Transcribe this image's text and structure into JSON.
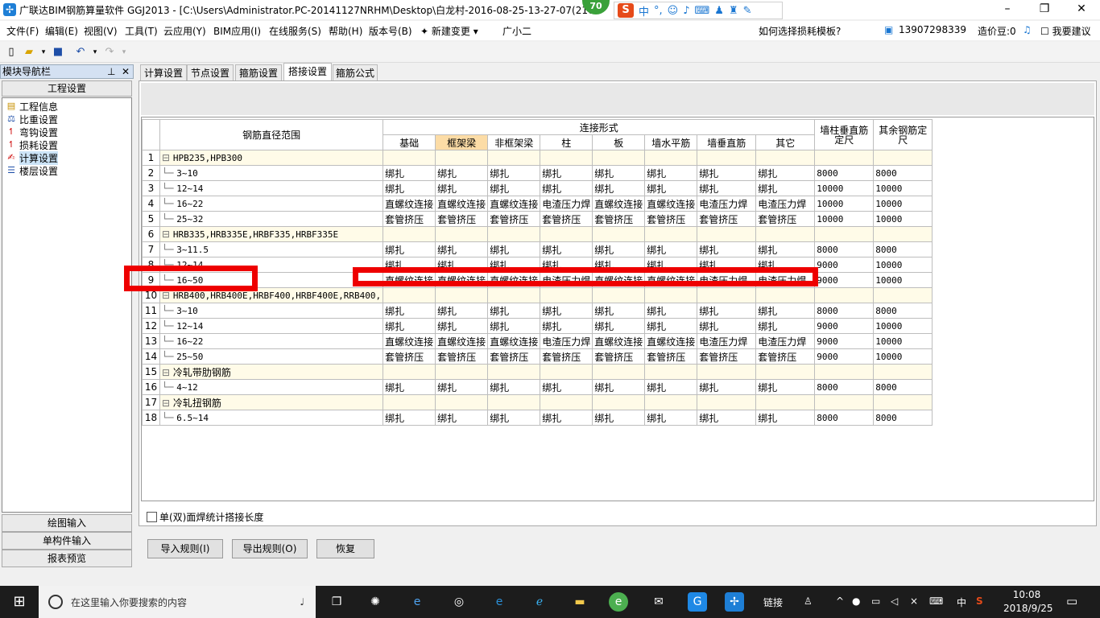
{
  "window": {
    "title": "广联达BIM钢筋算量软件 GGJ2013 - [C:\\Users\\Administrator.PC-20141127NRHM\\Desktop\\白龙村-2016-08-25-13-27-07(216",
    "badge": "70",
    "ime": {
      "logo": "S",
      "mode": "中",
      "punct": "°,"
    }
  },
  "menu": {
    "items": [
      "文件(F)",
      "编辑(E)",
      "视图(V)",
      "工具(T)",
      "云应用(Y)",
      "BIM应用(I)",
      "在线服务(S)",
      "帮助(H)",
      "版本号(B)",
      "新建变更",
      "广小二"
    ],
    "hint": "如何选择损耗模板?",
    "user": "13907298339",
    "coins": "造价豆:0",
    "feedback": "我要建议"
  },
  "nav": {
    "header": "模块导航栏",
    "section": "工程设置",
    "items": [
      {
        "label": "工程信息",
        "icon": "project-info-icon"
      },
      {
        "label": "比重设置",
        "icon": "weight-icon"
      },
      {
        "label": "弯钩设置",
        "icon": "hook-icon"
      },
      {
        "label": "损耗设置",
        "icon": "loss-icon"
      },
      {
        "label": "计算设置",
        "icon": "calc-icon"
      },
      {
        "label": "楼层设置",
        "icon": "floor-icon"
      }
    ],
    "bottom": [
      "绘图输入",
      "单构件输入",
      "报表预览"
    ]
  },
  "tabs": [
    "计算设置",
    "节点设置",
    "箍筋设置",
    "搭接设置",
    "箍筋公式"
  ],
  "active_tab": "搭接设置",
  "grid": {
    "h_range": "钢筋直径范围",
    "h_conn": "连接形式",
    "h_wall": "墙柱垂直筋定尺",
    "h_other": "其余钢筋定尺",
    "sub": [
      "基础",
      "框架梁",
      "非框架梁",
      "柱",
      "板",
      "墙水平筋",
      "墙垂直筋",
      "其它"
    ],
    "rows": [
      {
        "n": "1",
        "cat": true,
        "name": "HPB235,HPB300"
      },
      {
        "n": "2",
        "name": "3~10",
        "c": [
          "绑扎",
          "绑扎",
          "绑扎",
          "绑扎",
          "绑扎",
          "绑扎",
          "绑扎",
          "绑扎"
        ],
        "w": "8000",
        "o": "8000"
      },
      {
        "n": "3",
        "name": "12~14",
        "c": [
          "绑扎",
          "绑扎",
          "绑扎",
          "绑扎",
          "绑扎",
          "绑扎",
          "绑扎",
          "绑扎"
        ],
        "w": "10000",
        "o": "10000"
      },
      {
        "n": "4",
        "name": "16~22",
        "c": [
          "直螺纹连接",
          "直螺纹连接",
          "直螺纹连接",
          "电渣压力焊",
          "直螺纹连接",
          "直螺纹连接",
          "电渣压力焊",
          "电渣压力焊"
        ],
        "w": "10000",
        "o": "10000"
      },
      {
        "n": "5",
        "name": "25~32",
        "c": [
          "套管挤压",
          "套管挤压",
          "套管挤压",
          "套管挤压",
          "套管挤压",
          "套管挤压",
          "套管挤压",
          "套管挤压"
        ],
        "w": "10000",
        "o": "10000"
      },
      {
        "n": "6",
        "cat": true,
        "name": "HRB335,HRB335E,HRBF335,HRBF335E"
      },
      {
        "n": "7",
        "name": "3~11.5",
        "c": [
          "绑扎",
          "绑扎",
          "绑扎",
          "绑扎",
          "绑扎",
          "绑扎",
          "绑扎",
          "绑扎"
        ],
        "w": "8000",
        "o": "8000"
      },
      {
        "n": "8",
        "name": "12~14",
        "c": [
          "绑扎",
          "绑扎",
          "绑扎",
          "绑扎",
          "绑扎",
          "绑扎",
          "绑扎",
          "绑扎"
        ],
        "w": "9000",
        "o": "10000"
      },
      {
        "n": "9",
        "name": "16~50",
        "c": [
          "直螺纹连接",
          "直螺纹连接",
          "直螺纹连接",
          "电渣压力焊",
          "直螺纹连接",
          "直螺纹连接",
          "电渣压力焊",
          "电渣压力焊"
        ],
        "w": "9000",
        "o": "10000"
      },
      {
        "n": "10",
        "cat": true,
        "name": "HRB400,HRB400E,HRBF400,HRBF400E,RRB400,"
      },
      {
        "n": "11",
        "name": "3~10",
        "c": [
          "绑扎",
          "绑扎",
          "绑扎",
          "绑扎",
          "绑扎",
          "绑扎",
          "绑扎",
          "绑扎"
        ],
        "w": "8000",
        "o": "8000"
      },
      {
        "n": "12",
        "name": "12~14",
        "c": [
          "绑扎",
          "绑扎",
          "绑扎",
          "绑扎",
          "绑扎",
          "绑扎",
          "绑扎",
          "绑扎"
        ],
        "w": "9000",
        "o": "10000"
      },
      {
        "n": "13",
        "name": "16~22",
        "c": [
          "直螺纹连接",
          "直螺纹连接",
          "直螺纹连接",
          "电渣压力焊",
          "直螺纹连接",
          "直螺纹连接",
          "电渣压力焊",
          "电渣压力焊"
        ],
        "w": "9000",
        "o": "10000"
      },
      {
        "n": "14",
        "name": "25~50",
        "c": [
          "套管挤压",
          "套管挤压",
          "套管挤压",
          "套管挤压",
          "套管挤压",
          "套管挤压",
          "套管挤压",
          "套管挤压"
        ],
        "w": "9000",
        "o": "10000"
      },
      {
        "n": "15",
        "cat": true,
        "name": "冷轧带肋钢筋"
      },
      {
        "n": "16",
        "name": "4~12",
        "c": [
          "绑扎",
          "绑扎",
          "绑扎",
          "绑扎",
          "绑扎",
          "绑扎",
          "绑扎",
          "绑扎"
        ],
        "w": "8000",
        "o": "8000"
      },
      {
        "n": "17",
        "cat": true,
        "name": "冷轧扭钢筋"
      },
      {
        "n": "18",
        "name": "6.5~14",
        "c": [
          "绑扎",
          "绑扎",
          "绑扎",
          "绑扎",
          "绑扎",
          "绑扎",
          "绑扎",
          "绑扎"
        ],
        "w": "8000",
        "o": "8000"
      }
    ]
  },
  "option_label": "单(双)面焊统计搭接长度",
  "buttons": {
    "import": "导入规则(I)",
    "export": "导出规则(O)",
    "restore": "恢复"
  },
  "taskbar": {
    "search_placeholder": "在这里输入你要搜索的内容",
    "link": "链接",
    "lang": "中",
    "time": "10:08",
    "date": "2018/9/25"
  },
  "colors": {
    "highlight": "#e00000",
    "selected_header": "#fcdca6",
    "category_row": "#fffbe8"
  }
}
